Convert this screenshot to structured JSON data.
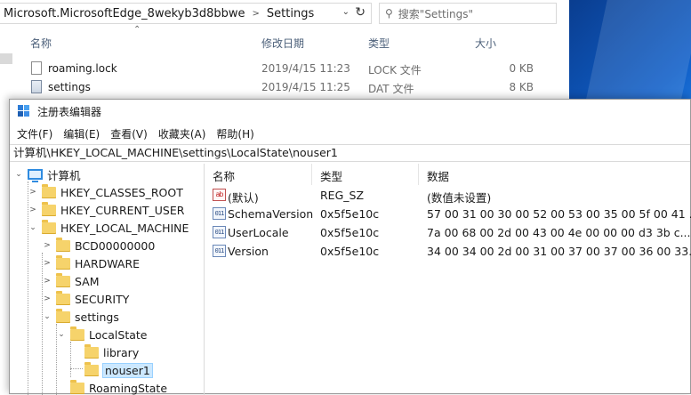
{
  "explorer": {
    "path_segments": [
      "Microsoft.MicrosoftEdge_8wekyb3d8bbwe",
      "Settings"
    ],
    "search_placeholder": "搜索\"Settings\"",
    "columns": {
      "name": "名称",
      "date": "修改日期",
      "type": "类型",
      "size": "大小"
    },
    "files": [
      {
        "name": "roaming.lock",
        "date": "2019/4/15 11:23",
        "type": "LOCK 文件",
        "size": "0 KB",
        "icon": "file-icon"
      },
      {
        "name": "settings",
        "date": "2019/4/15 11:25",
        "type": "DAT 文件",
        "size": "8 KB",
        "icon": "dat-file-icon"
      }
    ]
  },
  "regedit": {
    "title": "注册表编辑器",
    "menu": [
      "文件(F)",
      "编辑(E)",
      "查看(V)",
      "收藏夹(A)",
      "帮助(H)"
    ],
    "path": "计算机\\HKEY_LOCAL_MACHINE\\settings\\LocalState\\nouser1",
    "tree": [
      {
        "label": "计算机",
        "kind": "computer",
        "level": 0,
        "expanded": true
      },
      {
        "label": "HKEY_CLASSES_ROOT",
        "kind": "folder",
        "level": 1,
        "expanded": false
      },
      {
        "label": "HKEY_CURRENT_USER",
        "kind": "folder",
        "level": 1,
        "expanded": false
      },
      {
        "label": "HKEY_LOCAL_MACHINE",
        "kind": "folder",
        "level": 1,
        "expanded": true
      },
      {
        "label": "BCD00000000",
        "kind": "folder",
        "level": 2,
        "expanded": false
      },
      {
        "label": "HARDWARE",
        "kind": "folder",
        "level": 2,
        "expanded": false
      },
      {
        "label": "SAM",
        "kind": "folder",
        "level": 2,
        "expanded": false
      },
      {
        "label": "SECURITY",
        "kind": "folder",
        "level": 2,
        "expanded": false
      },
      {
        "label": "settings",
        "kind": "folder",
        "level": 2,
        "expanded": true
      },
      {
        "label": "LocalState",
        "kind": "folder",
        "level": 3,
        "expanded": true
      },
      {
        "label": "library",
        "kind": "folder",
        "level": 4,
        "expanded": null
      },
      {
        "label": "nouser1",
        "kind": "folder",
        "level": 4,
        "expanded": null,
        "selected": true
      },
      {
        "label": "RoamingState",
        "kind": "folder",
        "level": 3,
        "expanded": null
      }
    ],
    "columns": {
      "name": "名称",
      "type": "类型",
      "data": "数据"
    },
    "values": [
      {
        "name": "(默认)",
        "type": "REG_SZ",
        "data": "(数值未设置)",
        "icon": "string-value-icon"
      },
      {
        "name": "SchemaVersion",
        "type": "0x5f5e10c",
        "data": "57 00 31 00 30 00 52 00 53 00 35 00 5f 00 41 ...",
        "icon": "binary-value-icon"
      },
      {
        "name": "UserLocale",
        "type": "0x5f5e10c",
        "data": "7a 00 68 00 2d 00 43 00 4e 00 00 00 d3 3b c...",
        "icon": "binary-value-icon"
      },
      {
        "name": "Version",
        "type": "0x5f5e10c",
        "data": "34 00 34 00 2d 00 31 00 37 00 37 00 36 00 33...",
        "icon": "binary-value-icon"
      }
    ]
  }
}
